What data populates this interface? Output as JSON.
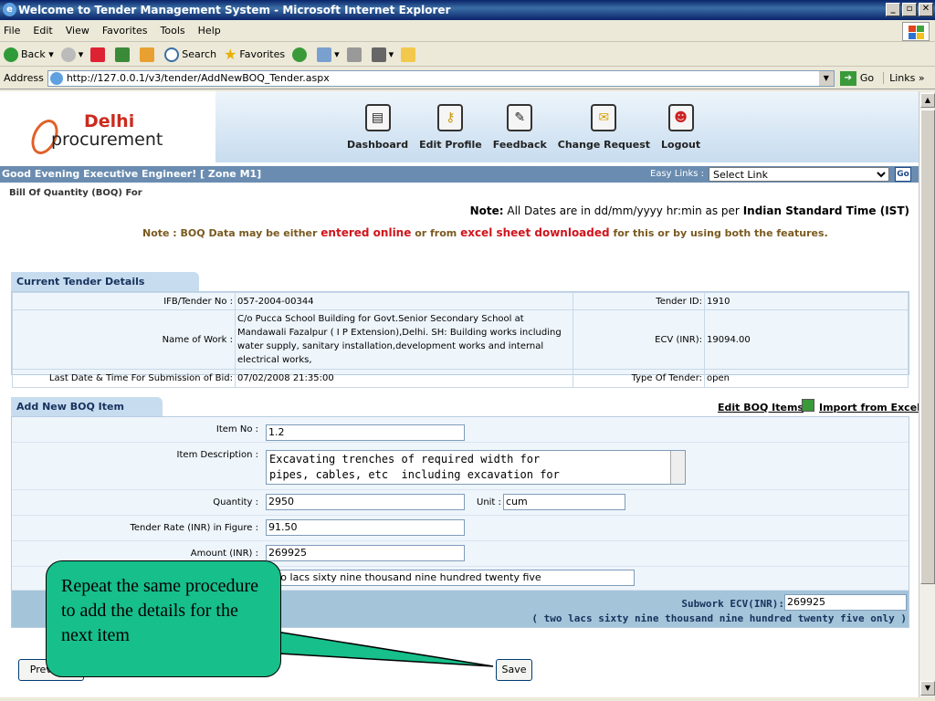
{
  "window": {
    "title": "Welcome to Tender Management System - Microsoft Internet Explorer"
  },
  "menu": [
    "File",
    "Edit",
    "View",
    "Favorites",
    "Tools",
    "Help"
  ],
  "toolbar": {
    "back": "Back",
    "search": "Search",
    "favorites": "Favorites"
  },
  "address": {
    "label": "Address",
    "url": "http://127.0.0.1/v3/tender/AddNewBOQ_Tender.aspx",
    "go": "Go",
    "links": "Links"
  },
  "logo": {
    "line1": "Delhi",
    "line2": "procurement"
  },
  "nav": [
    {
      "label": "Dashboard",
      "icon": "dashboard-icon"
    },
    {
      "label": "Edit Profile",
      "icon": "key-icon"
    },
    {
      "label": "Feedback",
      "icon": "feedback-icon"
    },
    {
      "label": "Change Request",
      "icon": "change-request-icon"
    },
    {
      "label": "Logout",
      "icon": "logout-icon"
    }
  ],
  "greeting": "Good Evening Executive Engineer!  [ Zone M1]",
  "easy_links": {
    "label": "Easy Links :",
    "selected": "Select Link",
    "go": "Go"
  },
  "boq_for": "Bill Of Quantity (BOQ) For",
  "note1": {
    "bold": "Note:",
    "text": " All Dates are in dd/mm/yyyy hr:min as per ",
    "ist": "Indian Standard Time (IST)"
  },
  "note2": {
    "a": "Note : BOQ Data may be either ",
    "b": "entered online",
    "c": " or from ",
    "d": "excel sheet downloaded",
    "e": " for this or by using both the features."
  },
  "tender": {
    "section": "Current Tender Details",
    "ifb_label": "IFB/Tender No :",
    "ifb": "057-2004-00344",
    "tid_label": "Tender ID:",
    "tid": "1910",
    "work_label": "Name of Work :",
    "work": "C/o Pucca School Building for Govt.Senior Secondary School at Mandawali Fazalpur ( I P Extension),Delhi. SH: Building works including water supply, sanitary installation,development works and internal electrical works,",
    "ecv_label": "ECV (INR):",
    "ecv": "19094.00",
    "last_label": "Last Date & Time For Submission of Bid:",
    "last": "07/02/2008 21:35:00",
    "type_label": "Type Of Tender:",
    "type": "open"
  },
  "boq": {
    "section": "Add New BOQ Item",
    "edit_link": "Edit BOQ Items",
    "import_link": "Import from Excel",
    "item_no_label": "Item No :",
    "item_no": "1.2",
    "desc_label": "Item Description :",
    "desc_line1": "Excavating trenches of required width for",
    "desc_line2": "pipes, cables, etc  including excavation for",
    "qty_label": "Quantity :",
    "qty": "2950",
    "unit_label": "Unit :",
    "unit": "cum",
    "rate_label": "Tender Rate (INR) in Figure :",
    "rate": "91.50",
    "amount_label": "Amount (INR) :",
    "amount": "269925",
    "words": "two lacs sixty nine thousand nine hundred twenty five",
    "subwork_label": "Subwork ECV(INR):",
    "subwork": "269925",
    "subwork_words": "( two lacs sixty nine thousand nine hundred twenty five only )"
  },
  "buttons": {
    "prev": "Previous",
    "save": "Save"
  },
  "callout": "Repeat the  same procedure to add the details for the next item"
}
